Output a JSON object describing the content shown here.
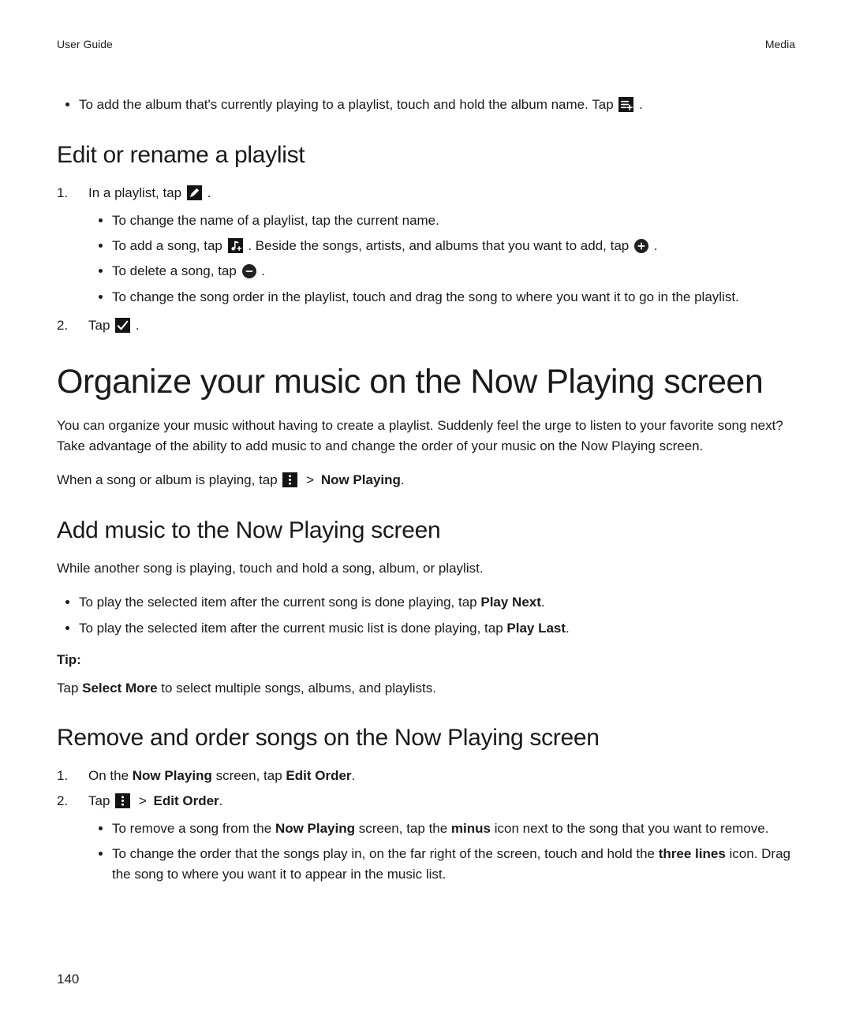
{
  "header": {
    "left": "User Guide",
    "right": "Media"
  },
  "top_bullet": {
    "prefix": "To add the album that's currently playing to a playlist, touch and hold the album name. Tap ",
    "suffix": " ."
  },
  "edit_section": {
    "heading": "Edit or rename a playlist",
    "step1": {
      "prefix": "In a playlist, tap ",
      "suffix": " ."
    },
    "sub": {
      "rename": "To change the name of a playlist, tap the current name.",
      "add": {
        "p1": "To add a song, tap ",
        "p2": " . Beside the songs, artists, and albums that you want to add, tap ",
        "p3": " ."
      },
      "delete": {
        "p1": "To delete a song, tap ",
        "p2": " ."
      },
      "reorder": "To change the song order in the playlist, touch and drag the song to where you want it to go in the playlist."
    },
    "step2": {
      "prefix": "Tap ",
      "suffix": " ."
    }
  },
  "organize": {
    "heading": "Organize your music on the Now Playing screen",
    "intro": "You can organize your music without having to create a playlist. Suddenly feel the urge to listen to your favorite song next? Take advantage of the ability to add music to and change the order of your music on the Now Playing screen.",
    "path": {
      "prefix": "When a song or album is playing, tap ",
      "sep": " > ",
      "target": "Now Playing",
      "suffix": "."
    }
  },
  "add_section": {
    "heading": "Add music to the Now Playing screen",
    "intro": "While another song is playing, touch and hold a song, album, or playlist.",
    "b1": {
      "prefix": "To play the selected item after the current song is done playing, tap ",
      "bold": "Play Next",
      "suffix": "."
    },
    "b2": {
      "prefix": "To play the selected item after the current music list is done playing, tap ",
      "bold": "Play Last",
      "suffix": "."
    },
    "tip_label": "Tip:",
    "tip_body": {
      "p1": "Tap ",
      "bold": "Select More",
      "p2": " to select multiple songs, albums, and playlists."
    }
  },
  "remove_section": {
    "heading": "Remove and order songs on the Now Playing screen",
    "step1": {
      "p1": "On the ",
      "b1": "Now Playing",
      "p2": " screen, tap ",
      "b2": "Edit Order",
      "p3": "."
    },
    "step2": {
      "p1": "Tap ",
      "sep": " > ",
      "b1": "Edit Order",
      "p2": "."
    },
    "sub1": {
      "p1": "To remove a song from the ",
      "b1": "Now Playing",
      "p2": " screen, tap the ",
      "b2": "minus",
      "p3": " icon next to the song that you want to remove."
    },
    "sub2": {
      "p1": "To change the order that the songs play in, on the far right of the screen, touch and hold the ",
      "b1": "three lines",
      "p2": " icon. Drag the song to where you want it to appear in the music list."
    }
  },
  "page_number": "140"
}
